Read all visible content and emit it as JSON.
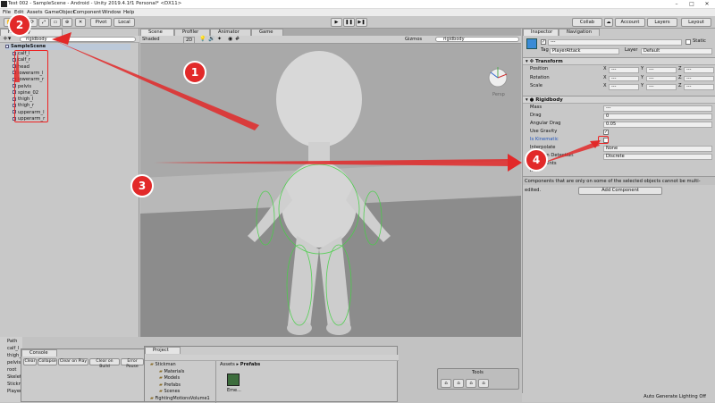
{
  "window": {
    "title": "Test 002 - SampleScene - Android - Unity 2019.4.1f1 Personal* <DX11>"
  },
  "menu": [
    "File",
    "Edit",
    "Assets",
    "GameObject",
    "Component",
    "Window",
    "Help"
  ],
  "toolbar": {
    "pivot": "Pivot",
    "local": "Local",
    "collab": "Collab",
    "account": "Account",
    "layers": "Layers",
    "layout": "Layout"
  },
  "hierarchy": {
    "tab": "Hierarchy",
    "search": "rigidbody",
    "scene": "SampleScene",
    "items": [
      "calf_l",
      "calf_r",
      "head",
      "lowerarm_l",
      "lowerarm_r",
      "pelvis",
      "spine_02",
      "thigh_l",
      "thigh_r",
      "upperarm_l",
      "upperarm_r"
    ]
  },
  "scene": {
    "tabs": [
      "Scene",
      "Profiler",
      "Animator",
      "Game"
    ],
    "shading": "Shaded",
    "mode": "2D",
    "gizmos": "Gizmos",
    "search": "rigidbody",
    "persp": "Persp"
  },
  "inspector": {
    "tabs": [
      "Inspector",
      "Navigation"
    ],
    "name": "---",
    "static": "Static",
    "tag_label": "Tag",
    "tag": "PlayerAttack",
    "layer_label": "Layer",
    "layer": "Default",
    "transform": {
      "title": "Transform",
      "rows": [
        {
          "label": "Position",
          "x": "---",
          "y": "---",
          "z": "---"
        },
        {
          "label": "Rotation",
          "x": "---",
          "y": "---",
          "z": "---"
        },
        {
          "label": "Scale",
          "x": "---",
          "y": "---",
          "z": "---"
        }
      ]
    },
    "rigidbody": {
      "title": "Rigidbody",
      "mass_label": "Mass",
      "mass": "---",
      "drag_label": "Drag",
      "drag": "0",
      "angular_label": "Angular Drag",
      "angular": "0.05",
      "gravity_label": "Use Gravity",
      "kinematic_label": "Is Kinematic",
      "interp_label": "Interpolate",
      "interp": "None",
      "collision_label": "Collision Detection",
      "collision": "Discrete",
      "constraints_label": "Constraints",
      "info_label": "Info"
    },
    "note": "Components that are only on some of the selected objects cannot be multi-edited.",
    "add_component": "Add Component"
  },
  "console": {
    "tab": "Console",
    "buttons": [
      "Clear",
      "Collapse",
      "Clear on Play",
      "Clear on Build",
      "Error Pause"
    ]
  },
  "project": {
    "tab": "Project",
    "folders": [
      "Stickman",
      "Materials",
      "Models",
      "Prefabs",
      "Scenes",
      "FightingMotionsVolume1"
    ],
    "breadcrumb": [
      "Assets",
      "Prefabs"
    ],
    "asset": "Eme..."
  },
  "left_panel": {
    "items": [
      "Path",
      "calf_l",
      "thigh_l",
      "pelvis",
      "root",
      "Skelet",
      "Stickm",
      "Player"
    ]
  },
  "tools": {
    "title": "Tools"
  },
  "status": "Auto Generate Lighting Off",
  "annotations": [
    "1",
    "2",
    "3",
    "4"
  ]
}
